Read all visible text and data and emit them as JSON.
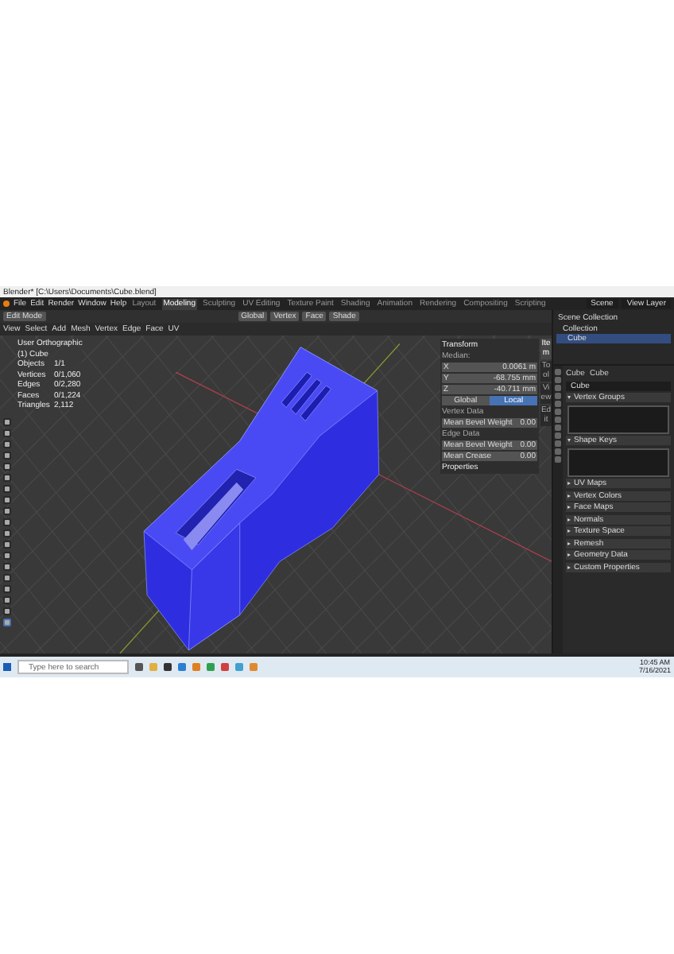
{
  "window": {
    "title": "Blender* [C:\\Users\\Documents\\Cube.blend]"
  },
  "menu": [
    "File",
    "Edit",
    "Render",
    "Window",
    "Help"
  ],
  "workspaces": [
    {
      "label": "Layout",
      "selected": false
    },
    {
      "label": "Modeling",
      "selected": true
    },
    {
      "label": "Sculpting",
      "selected": false
    },
    {
      "label": "UV Editing",
      "selected": false
    },
    {
      "label": "Texture Paint",
      "selected": false
    },
    {
      "label": "Shading",
      "selected": false
    },
    {
      "label": "Animation",
      "selected": false
    },
    {
      "label": "Rendering",
      "selected": false
    },
    {
      "label": "Compositing",
      "selected": false
    },
    {
      "label": "Scripting",
      "selected": false
    }
  ],
  "scene": "Scene",
  "view_layer": "View Layer",
  "header": {
    "mode": "Edit Mode",
    "orientation": "Global",
    "options": [
      "Vertex",
      "Face",
      "Shade"
    ]
  },
  "edit_menus": [
    "View",
    "Select",
    "Add",
    "Mesh",
    "Vertex",
    "Edge",
    "Face",
    "UV"
  ],
  "viewport_info": {
    "view": "User Orthographic",
    "object": "(1) Cube",
    "stats": [
      {
        "label": "Objects",
        "value": "1/1"
      },
      {
        "label": "Vertices",
        "value": "0/1,060"
      },
      {
        "label": "Edges",
        "value": "0/2,280"
      },
      {
        "label": "Faces",
        "value": "0/1,224"
      },
      {
        "label": "Triangles",
        "value": "2,112"
      }
    ]
  },
  "tools": [
    {
      "selected": false
    },
    {
      "selected": false
    },
    {
      "selected": false
    },
    {
      "selected": false
    },
    {
      "selected": false
    },
    {
      "selected": false
    },
    {
      "selected": false
    },
    {
      "selected": false
    },
    {
      "selected": false
    },
    {
      "selected": false
    },
    {
      "selected": false
    },
    {
      "selected": false
    },
    {
      "selected": false
    },
    {
      "selected": false
    },
    {
      "selected": false
    },
    {
      "selected": false
    },
    {
      "selected": false
    },
    {
      "selected": false
    },
    {
      "selected": true
    }
  ],
  "sidebar": {
    "title": "Transform",
    "median": "Median:",
    "fields": [
      {
        "label": "X",
        "value": "0.0061 m"
      },
      {
        "label": "Y",
        "value": "-68.755 mm"
      },
      {
        "label": "Z",
        "value": "-40.711 mm"
      }
    ],
    "space": [
      {
        "label": "Global",
        "selected": false
      },
      {
        "label": "Local",
        "selected": true
      }
    ],
    "sections": [
      {
        "title": "Vertex Data",
        "rows": [
          {
            "label": "Mean Bevel Weight",
            "value": "0.00"
          }
        ]
      },
      {
        "title": "Edge Data",
        "rows": [
          {
            "label": "Mean Bevel Weight",
            "value": "0.00"
          },
          {
            "label": "Mean Crease",
            "value": "0.00"
          }
        ]
      }
    ],
    "properties": "Properties",
    "tabs": [
      {
        "label": "Item",
        "selected": true
      },
      {
        "label": "Tool",
        "selected": false
      },
      {
        "label": "View",
        "selected": false
      },
      {
        "label": "Edit",
        "selected": false
      }
    ]
  },
  "outliner": [
    {
      "label": "Scene Collection",
      "selected": false,
      "children": [
        {
          "label": "Collection",
          "selected": false,
          "children": [
            {
              "label": "Cube",
              "selected": true
            }
          ]
        }
      ]
    }
  ],
  "properties": {
    "object": "Cube",
    "data": "Cube",
    "mesh": "Cube",
    "panels": [
      {
        "label": "Vertex Groups",
        "expanded": true
      },
      {
        "label": "Shape Keys",
        "expanded": true
      },
      {
        "label": "UV Maps",
        "expanded": false
      },
      {
        "label": "Vertex Colors",
        "expanded": false
      },
      {
        "label": "Face Maps",
        "expanded": false
      },
      {
        "label": "Normals",
        "expanded": false
      },
      {
        "label": "Texture Space",
        "expanded": false
      },
      {
        "label": "Remesh",
        "expanded": false
      },
      {
        "label": "Geometry Data",
        "expanded": false
      },
      {
        "label": "Custom Properties",
        "expanded": false
      }
    ]
  },
  "taskbar": {
    "search_placeholder": "Type here to search",
    "time": "10:45 AM",
    "date": "7/16/2021"
  }
}
